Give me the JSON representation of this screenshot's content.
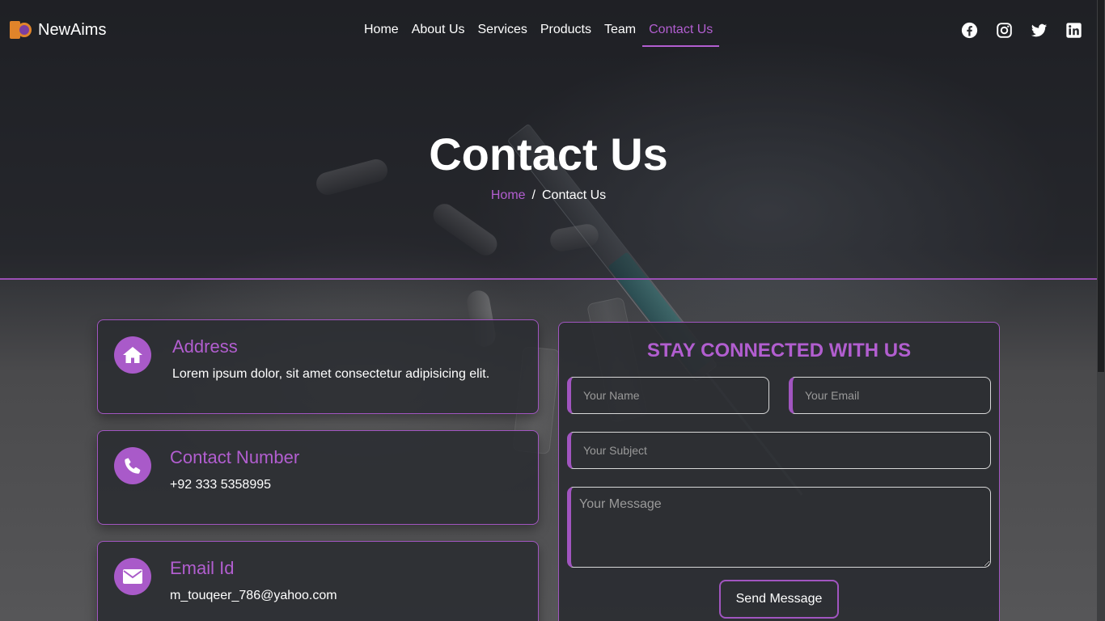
{
  "brand": {
    "name": "NewAims"
  },
  "nav": {
    "items": [
      {
        "label": "Home"
      },
      {
        "label": "About Us"
      },
      {
        "label": "Services"
      },
      {
        "label": "Products"
      },
      {
        "label": "Team"
      },
      {
        "label": "Contact Us",
        "active": true
      }
    ],
    "social_icons": [
      "facebook-icon",
      "instagram-icon",
      "twitter-icon",
      "linkedin-icon"
    ]
  },
  "hero": {
    "title": "Contact Us",
    "breadcrumb": {
      "home": "Home",
      "separator": "/",
      "current": "Contact Us"
    }
  },
  "info_cards": [
    {
      "icon": "home-icon",
      "title": "Address",
      "text": "Lorem ipsum dolor, sit amet consectetur adipisicing elit."
    },
    {
      "icon": "phone-icon",
      "title": "Contact Number",
      "text": "+92 333 5358995"
    },
    {
      "icon": "envelope-icon",
      "title": "Email Id",
      "text": "m_touqeer_786@yahoo.com"
    }
  ],
  "form": {
    "title": "STAY CONNECTED WITH US",
    "name_placeholder": "Your Name",
    "email_placeholder": "Your Email",
    "subject_placeholder": "Your Subject",
    "message_placeholder": "Your Message",
    "submit_label": "Send Message"
  },
  "colors": {
    "accent": "#b25ed0",
    "card_bg": "#2a2c31",
    "icon_bg": "#a95ac9"
  }
}
